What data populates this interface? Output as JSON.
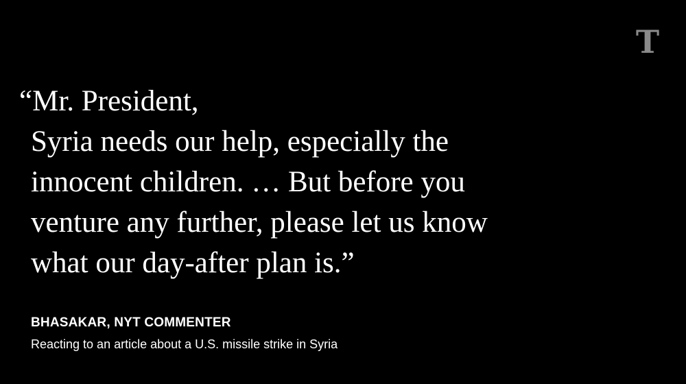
{
  "logo": {
    "icon": "nyt-t-logo-icon",
    "glyph": "T",
    "color": "#8a8a8a"
  },
  "quote": {
    "lines": [
      "“Mr. President,",
      "Syria needs our help, especially the",
      "innocent children. … But before you",
      "venture any further, please let us know",
      "what our day-after plan is.”"
    ]
  },
  "attribution": {
    "author": "BHASAKAR, NYT COMMENTER",
    "context": "Reacting to an article about a U.S. missile strike in Syria"
  },
  "colors": {
    "background": "#000000",
    "text": "#ffffff"
  }
}
